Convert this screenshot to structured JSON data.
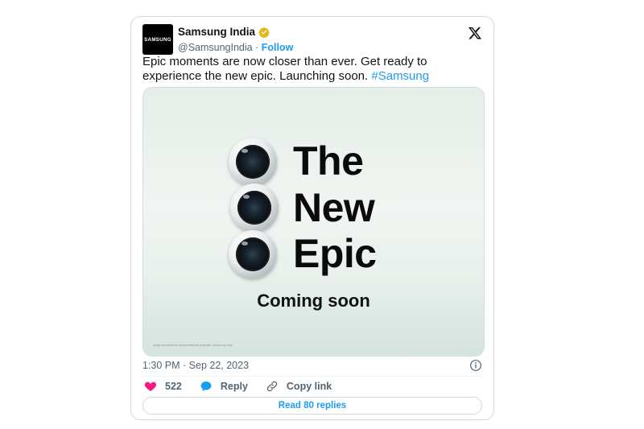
{
  "account": {
    "name": "Samsung India",
    "handle": "@SamsungIndia",
    "separator": " · ",
    "follow_label": "Follow",
    "avatar_text": "SAMSUNG",
    "verified_badge": "gold-check-icon"
  },
  "tweet": {
    "text_main": "Epic moments are now closer than ever. Get ready to experience the new epic. Launching soon. ",
    "hashtag": "#Samsung",
    "timestamp": "1:30 PM · Sep 22, 2023"
  },
  "media": {
    "headline_line1": "The",
    "headline_line2": "New",
    "headline_line3": "Epic",
    "subline": "Coming soon",
    "fineprint": "Image simulated for representational purposes, actual may vary."
  },
  "actions": {
    "like_count": "522",
    "reply_label": "Reply",
    "copy_link_label": "Copy link"
  },
  "footer": {
    "read_replies_label": "Read 80 replies"
  },
  "colors": {
    "accent": "#1d9bf0",
    "like": "#f91880",
    "text": "#0f1419",
    "muted": "#536471"
  }
}
